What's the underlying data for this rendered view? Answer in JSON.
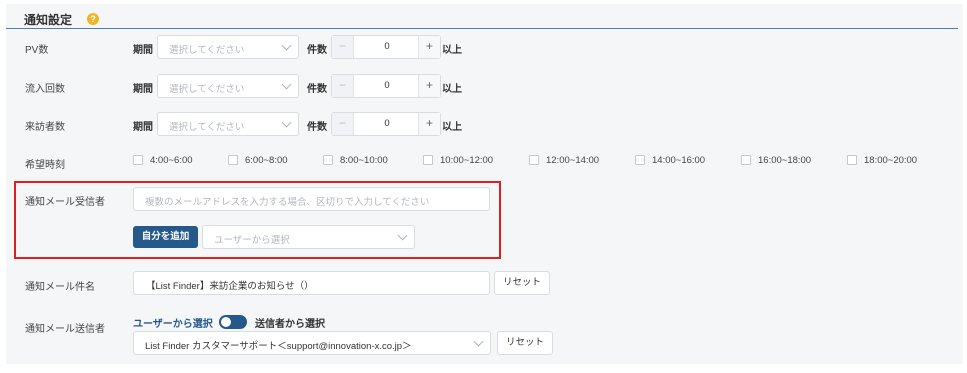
{
  "section": {
    "title": "通知設定",
    "help_icon": "?"
  },
  "metric_rows": [
    {
      "label": "PV数",
      "period_label": "期間",
      "period_placeholder": "選択してください",
      "count_label": "件数",
      "count_value": "0",
      "minus": "−",
      "plus": "+",
      "suffix": "以上"
    },
    {
      "label": "流入回数",
      "period_label": "期間",
      "period_placeholder": "選択してください",
      "count_label": "件数",
      "count_value": "0",
      "minus": "−",
      "plus": "+",
      "suffix": "以上"
    },
    {
      "label": "来訪者数",
      "period_label": "期間",
      "period_placeholder": "選択してください",
      "count_label": "件数",
      "count_value": "0",
      "minus": "−",
      "plus": "+",
      "suffix": "以上"
    }
  ],
  "time_row": {
    "label": "希望時刻",
    "options": [
      "4:00~6:00",
      "6:00~8:00",
      "8:00~10:00",
      "10:00~12:00",
      "12:00~14:00",
      "14:00~16:00",
      "16:00~18:00",
      "18:00~20:00"
    ]
  },
  "recipients": {
    "label": "通知メール受信者",
    "placeholder": "複数のメールアドレスを入力する場合、区切りで入力してください",
    "add_self_button": "自分を追加",
    "user_select_placeholder": "ユーザーから選択"
  },
  "subject": {
    "label": "通知メール件名",
    "value": "【List Finder】来訪企業のお知らせ（）",
    "reset_button": "リセット"
  },
  "sender": {
    "label": "通知メール送信者",
    "option_user": "ユーザーから選択",
    "option_sender": "送信者から選択",
    "toggle_state": "user",
    "select_value": "List Finder カスタマーサポート＜support@innovation-x.co.jp＞",
    "reset_button": "リセット"
  },
  "colors": {
    "accent": "#25598c",
    "highlight": "#e02020",
    "help": "#f0b429"
  }
}
